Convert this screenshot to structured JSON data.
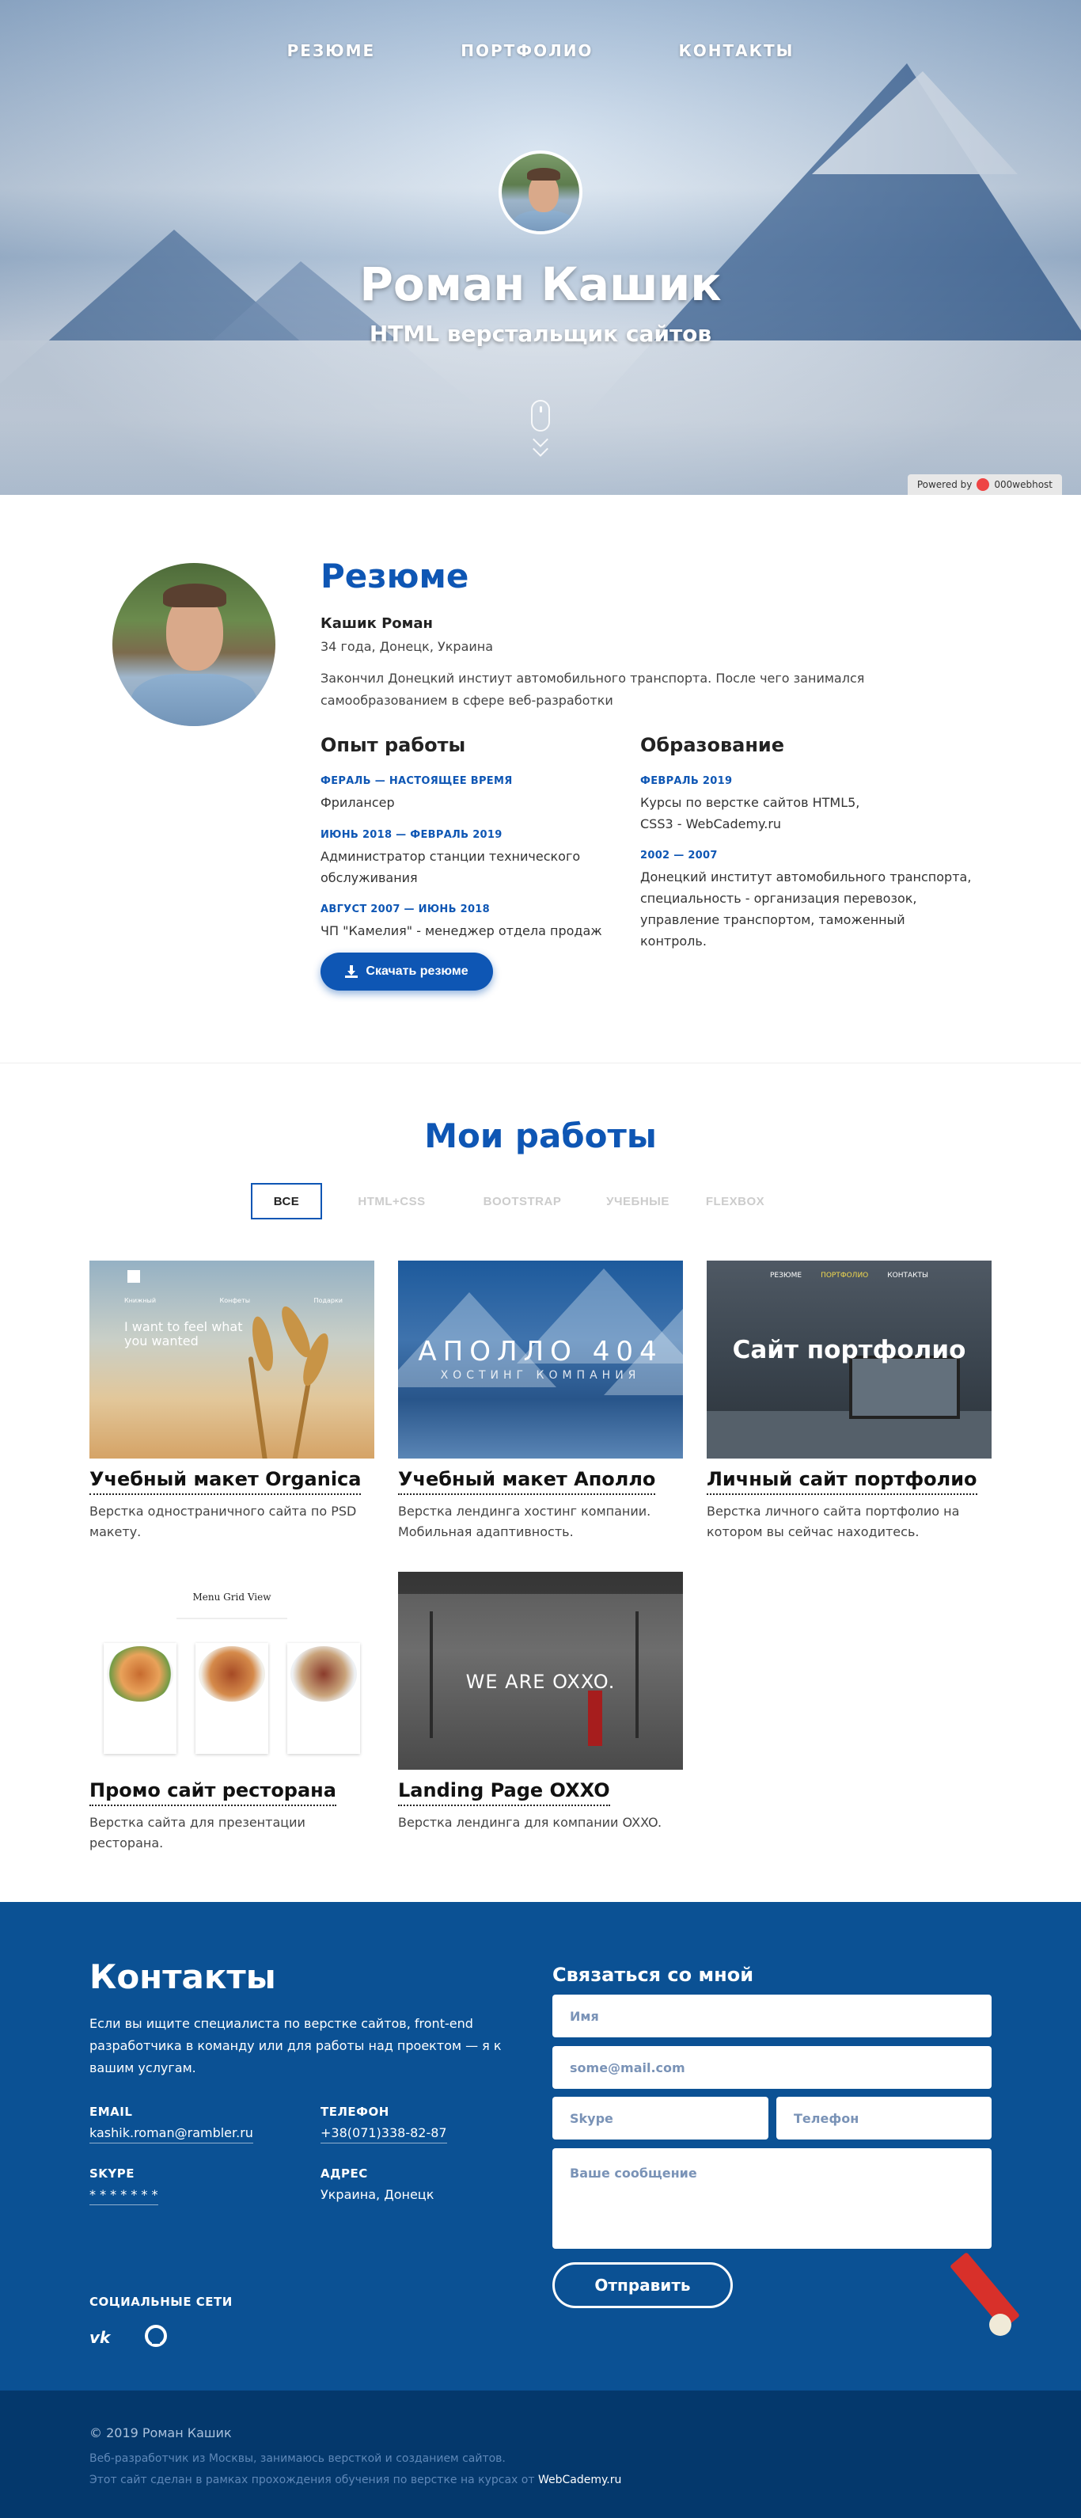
{
  "nav": [
    "РЕЗЮМЕ",
    "ПОРТФОЛИО",
    "КОНТАКТЫ"
  ],
  "hero": {
    "name": "Роман Кашик",
    "subtitle": "HTML верстальщик сайтов",
    "powered_label": "Powered by",
    "powered_brand": "000webhost"
  },
  "resume": {
    "title": "Резюме",
    "name": "Кашик Роман",
    "age_city": "34 года, Донецк, Украина",
    "description": "Закончил Донецкий инстиут автомобильного транспорта. После чего занимался самообразованием в сфере веб-разработки",
    "experience_title": "Опыт работы",
    "experience": [
      {
        "period": "ФЕРАЛЬ — НАСТОЯЩЕЕ ВРЕМЯ",
        "place": "Фрилансер"
      },
      {
        "period": "ИЮНЬ 2018 — ФЕВРАЛЬ 2019",
        "place": "Администратор станции технического обслуживания"
      },
      {
        "period": "АВГУСТ 2007 — ИЮНЬ 2018",
        "place": "ЧП \"Камелия\" - менеджер отдела продаж"
      }
    ],
    "education_title": "Образование",
    "education": [
      {
        "period": "ФЕВРАЛЬ 2019",
        "place": "Курсы по верстке сайтов HTML5, CSS3 - WebCademy.ru"
      },
      {
        "period": "2002 — 2007",
        "place": "Донецкий институт автомобильного транспорта, специальность - организация перевозок, управление транспортом, таможенный контроль."
      }
    ],
    "download_label": "Скачать резюме"
  },
  "works": {
    "title": "Мои работы",
    "filters": [
      "ВСЕ",
      "HTML+CSS",
      "BOOTSTRAP",
      "УЧЕБНЫЕ",
      "FLEXBOX"
    ],
    "active_filter": 0,
    "items": [
      {
        "title": "Учебный макет Organica",
        "desc": "Верстка одностраничного сайта по PSD макету.",
        "thumb_text": "I want to feel what you wanted",
        "thumb_nav": [
          "Книжный",
          "Конфеты",
          "Подарки"
        ]
      },
      {
        "title": "Учебный макет Аполло",
        "desc": "Верстка лендинга хостинг компании. Мобильная адаптивность.",
        "thumb_big": "АПОЛЛО 404",
        "thumb_small": "ХОСТИНГ КОМПАНИЯ"
      },
      {
        "title": "Личный сайт портфолио",
        "desc": "Верстка личного сайта портфолио на котором вы сейчас находитесь.",
        "thumb_big": "Сайт портфолио",
        "thumb_nav": [
          "РЕЗЮМЕ",
          "ПОРТФОЛИО",
          "КОНТАКТЫ"
        ]
      },
      {
        "title": "Промо сайт ресторана",
        "desc": "Верстка сайта для презентации ресторана.",
        "thumb_head": "Menu Grid View"
      },
      {
        "title": "Landing Page OXXO",
        "desc": "Верстка лендинга для компании OXXO.",
        "thumb_big": "WE ARE OXXO."
      }
    ]
  },
  "contacts": {
    "title": "Контакты",
    "lead": "Если вы ищите специалиста по верстке сайтов, front-end разработчика в команду или для работы над проектом — я к вашим услугам.",
    "email_label": "EMAIL",
    "email": "kashik.roman@rambler.ru",
    "phone_label": "ТЕЛЕФОН",
    "phone": "+38(071)338-82-87",
    "skype_label": "SKYPE",
    "skype": "* * * * * * *",
    "address_label": "АДРЕС",
    "address": "Украина, Донецк",
    "social_label": "СОЦИАЛЬНЫЕ СЕТИ",
    "vk": "vk",
    "form_title": "Связаться со мной",
    "ph_name": "Имя",
    "ph_email": "some@mail.com",
    "ph_skype": "Skype",
    "ph_phone": "Телефон",
    "ph_message": "Ваше сообщение",
    "send_label": "Отправить"
  },
  "footer": {
    "copy": "© 2019 Роман Кашик",
    "line1": "Веб-разработчик из Москвы, занимаюсь версткой и созданием сайтов.",
    "line2": "Этот сайт сделан в рамках прохождения обучения по верстке на курсах от",
    "link": "WebCademy.ru"
  },
  "colors": {
    "accent": "#0e56b4",
    "contacts_bg": "#0b5194",
    "footer_bg": "#04386c"
  }
}
